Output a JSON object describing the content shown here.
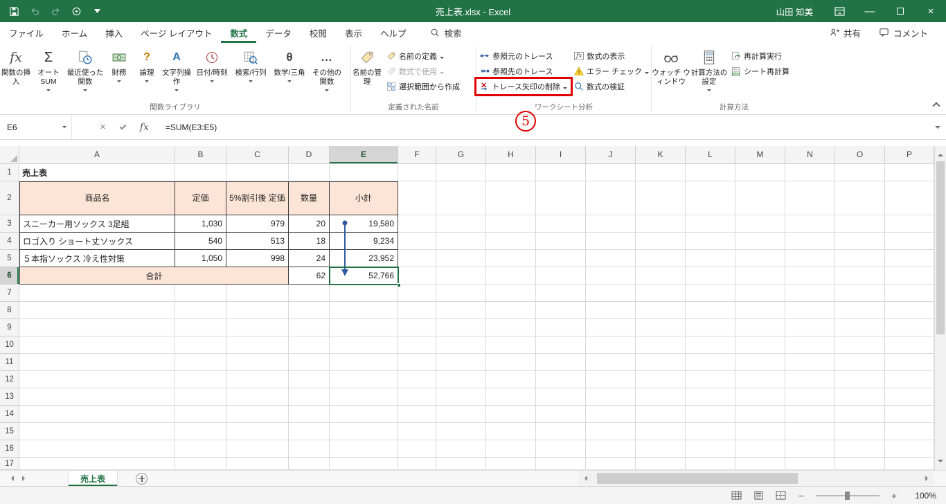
{
  "titlebar": {
    "title": "売上表.xlsx - Excel",
    "user": "山田 知美"
  },
  "ribbon": {
    "tabs": [
      {
        "label": "ファイル"
      },
      {
        "label": "ホーム"
      },
      {
        "label": "挿入"
      },
      {
        "label": "ページ レイアウト"
      },
      {
        "label": "数式"
      },
      {
        "label": "データ"
      },
      {
        "label": "校閲"
      },
      {
        "label": "表示"
      },
      {
        "label": "ヘルプ"
      }
    ],
    "search_label": "検索",
    "share_label": "共有",
    "comments_label": "コメント",
    "groups": {
      "function_library": {
        "label": "関数ライブラリ",
        "insert_function": "関数の挿入",
        "autosum": "オート SUM",
        "recent": "最近使った関数",
        "financial": "財務",
        "logical": "論理",
        "text": "文字列操作",
        "datetime": "日付/時刻",
        "lookup": "検索/行列",
        "math": "数学/三角",
        "more": "その他の関数"
      },
      "defined_names": {
        "label": "定義された名前",
        "name_manager": "名前の管理",
        "define_name": "名前の定義",
        "use_in_formula": "数式で使用",
        "create_from_selection": "選択範囲から作成"
      },
      "formula_auditing": {
        "label": "ワークシート分析",
        "trace_precedents": "参照元のトレース",
        "trace_dependents": "参照先のトレース",
        "remove_arrows": "トレース矢印の削除",
        "show_formulas": "数式の表示",
        "error_checking": "エラー チェック",
        "evaluate_formula": "数式の検証"
      },
      "calculation": {
        "label": "計算方法",
        "watch_window": "ウォッチ ウィンドウ",
        "calc_options": "計算方法の設定",
        "calc_now": "再計算実行",
        "calc_sheet": "シート再計算"
      }
    }
  },
  "annotation": {
    "step": "5"
  },
  "formula_bar": {
    "cell_ref": "E6",
    "formula": "=SUM(E3:E5)"
  },
  "grid": {
    "columns": [
      "A",
      "B",
      "C",
      "D",
      "E",
      "F",
      "G",
      "H",
      "I",
      "J",
      "K",
      "L",
      "M",
      "N",
      "O",
      "P"
    ],
    "rows": [
      "1",
      "2",
      "3",
      "4",
      "5",
      "6",
      "7",
      "8",
      "9",
      "10",
      "11",
      "12",
      "13",
      "14",
      "15",
      "16",
      "17"
    ],
    "selected": {
      "column": "E",
      "row": "6",
      "ref": "E6"
    },
    "cells": [
      {
        "ref": "A1",
        "text": "売上表",
        "type": "title"
      },
      {
        "ref": "A2",
        "text": "商品名",
        "type": "header"
      },
      {
        "ref": "B2",
        "text": "定価",
        "type": "header"
      },
      {
        "ref": "C2",
        "text": "5%割引後 定価",
        "type": "header"
      },
      {
        "ref": "D2",
        "text": "数量",
        "type": "header"
      },
      {
        "ref": "E2",
        "text": "小計",
        "type": "header"
      },
      {
        "ref": "A3",
        "text": "スニーカー用ソックス 3足組",
        "type": "text"
      },
      {
        "ref": "B3",
        "text": "1,030",
        "type": "number"
      },
      {
        "ref": "C3",
        "text": "979",
        "type": "number"
      },
      {
        "ref": "D3",
        "text": "20",
        "type": "number"
      },
      {
        "ref": "E3",
        "text": "19,580",
        "type": "number"
      },
      {
        "ref": "A4",
        "text": "ロゴ入り ショート丈ソックス",
        "type": "text"
      },
      {
        "ref": "B4",
        "text": "540",
        "type": "number"
      },
      {
        "ref": "C4",
        "text": "513",
        "type": "number"
      },
      {
        "ref": "D4",
        "text": "18",
        "type": "number"
      },
      {
        "ref": "E4",
        "text": "9,234",
        "type": "number"
      },
      {
        "ref": "A5",
        "text": "５本指ソックス 冷え性対策",
        "type": "text"
      },
      {
        "ref": "B5",
        "text": "1,050",
        "type": "number"
      },
      {
        "ref": "C5",
        "text": "998",
        "type": "number"
      },
      {
        "ref": "D5",
        "text": "24",
        "type": "number"
      },
      {
        "ref": "E5",
        "text": "23,952",
        "type": "number"
      },
      {
        "ref": "A6",
        "text": "合計",
        "type": "total",
        "span": 3
      },
      {
        "ref": "D6",
        "text": "62",
        "type": "number"
      },
      {
        "ref": "E6",
        "text": "52,766",
        "type": "number",
        "selected": true
      }
    ],
    "trace_arrow": {
      "from": "E3",
      "to": "E6"
    }
  },
  "sheet_tabs": {
    "active": "売上表"
  },
  "status_bar": {
    "zoom": "100%",
    "zoom_out": "−",
    "zoom_in": "+"
  },
  "icons": {
    "sigma": "Σ",
    "fx": "fx",
    "question": "?",
    "letter_a": "A",
    "theta": "θ",
    "ellipsis": "…",
    "close": "×",
    "minimize": "—"
  },
  "colors": {
    "accent_green": "#217346",
    "table_header_fill": "#FCE4D6",
    "highlight_red": "#E10000",
    "trace_arrow_blue": "#2E5B9F"
  }
}
